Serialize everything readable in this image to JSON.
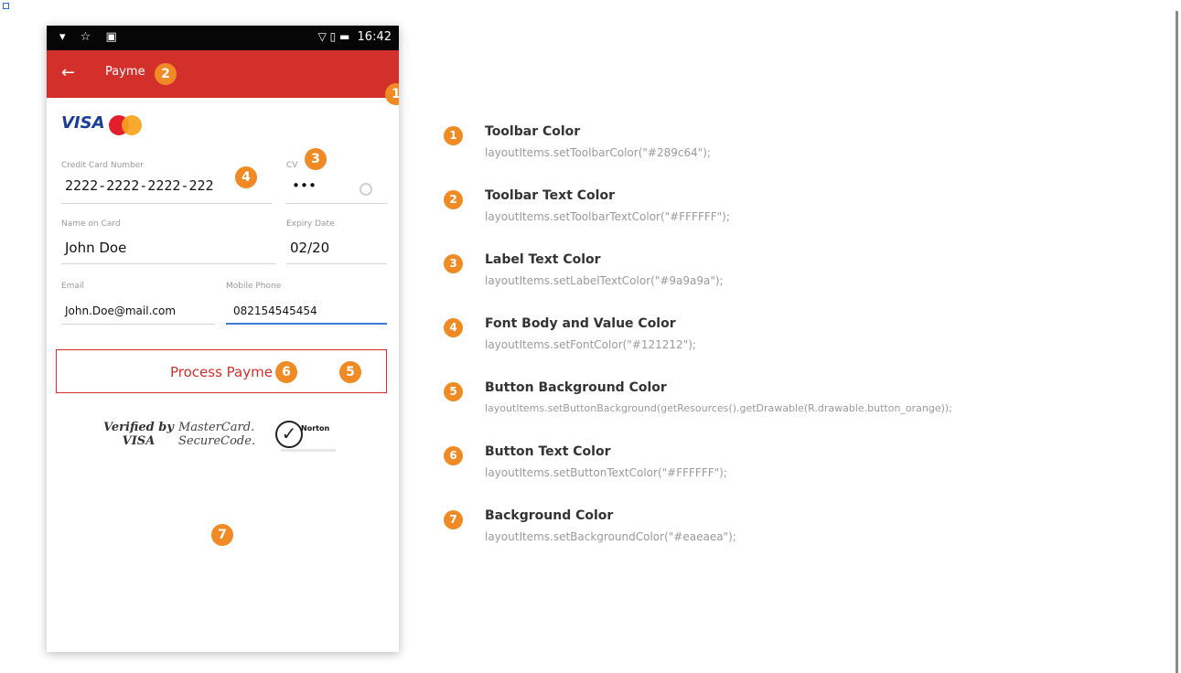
{
  "statusbar": {
    "left_icons": "▾ ☆ ▣",
    "right_icons": "▽ ▯ ▬",
    "time": "16:42"
  },
  "toolbar": {
    "back_icon": "←",
    "title": "Payme"
  },
  "form": {
    "card_number_label": "Credit Card Number",
    "card_number_value": "2222-2222-2222-222",
    "cvv_label": "CV",
    "cvv_value": "•••",
    "name_label": "Name on Card",
    "name_value": "John Doe",
    "expiry_label": "Expiry Date",
    "expiry_value": "02/20",
    "email_label": "Email",
    "email_value": "John.Doe@mail.com",
    "phone_label": "Mobile Phone",
    "phone_value": "082154545454"
  },
  "button": {
    "label": "Process Payme"
  },
  "security": {
    "vbv_line1": "Verified by",
    "vbv_line2": "VISA",
    "mc_line1": "MasterCard.",
    "mc_line2": "SecureCode.",
    "norton_text": "Norton",
    "norton_check": "✓"
  },
  "brand": {
    "visa": "VISA"
  },
  "badges": {
    "b1": "1",
    "b2": "2",
    "b3": "3",
    "b4": "4",
    "b5": "5",
    "b6": "6",
    "b7": "7"
  },
  "legend": [
    {
      "num": "1",
      "title": "Toolbar Color",
      "code": "layoutItems.setToolbarColor(\"#289c64\");"
    },
    {
      "num": "2",
      "title": "Toolbar Text Color",
      "code": "layoutItems.setToolbarTextColor(\"#FFFFFF\");"
    },
    {
      "num": "3",
      "title": "Label Text Color",
      "code": "layoutItems.setLabelTextColor(\"#9a9a9a\");"
    },
    {
      "num": "4",
      "title": "Font Body and Value Color",
      "code": "layoutItems.setFontColor(\"#121212\");"
    },
    {
      "num": "5",
      "title": "Button Background Color",
      "code": "layoutItems.setButtonBackground(getResources().getDrawable(R.drawable.button_orange));"
    },
    {
      "num": "6",
      "title": "Button Text Color",
      "code": "layoutItems.setButtonTextColor(\"#FFFFFF\");"
    },
    {
      "num": "7",
      "title": "Background Color",
      "code": "layoutItems.setBackgroundColor(\"#eaeaea\");"
    }
  ],
  "colors": {
    "toolbar": "#d3302b",
    "badge": "#ef8a25",
    "label": "#9a9a9a",
    "value": "#121212",
    "active_underline": "#3b7bd6"
  }
}
